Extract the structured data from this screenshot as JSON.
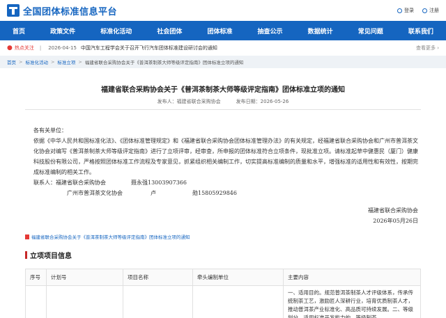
{
  "header": {
    "site_title": "全国团体标准信息平台",
    "login_label": "登录",
    "register_label": "注册"
  },
  "nav": {
    "items": [
      "首页",
      "政策文件",
      "标准化活动",
      "社会团体",
      "团体标准",
      "抽查公示",
      "数据统计",
      "常见问题",
      "联系我们"
    ]
  },
  "hot": {
    "label": "热点关注",
    "date": "2026-04-15",
    "text": "中国汽车工程学会关于召开飞行汽车团体标准建设研讨会的通知",
    "more": "查看更多"
  },
  "breadcrumb": [
    "首页",
    "标准化活动",
    "标准立项",
    "福建省联合采购协会关于《普洱茶制茶大师等级评定指南》团体标准立项的通知"
  ],
  "article": {
    "title": "福建省联合采购协会关于《普洱茶制茶大师等级评定指南》团体标准立项的通知",
    "publisher": "发布人：福建省联合采购协会",
    "publish_time": "发布日期：2026-05-26",
    "salutation": "各有关单位：",
    "paragraph": "依据《中华人民共和国标准化法》、《团体标准管理规定》和《福建省联合采购协会团体标准管理办法》的有关规定，经福建省联合采购协会和广州市普洱茶文化协会对编写《普洱茶制茶大师等级评定指南》进行了立项评审，经审查，所申报的团体标准符合立项条件，现批准立项。请标准起草中健惠民（厦门）健康科技股份有限公司，严格按照团体标准工作流程及专家意见，抓紧组织相关编制工作，切实提高标准编制的质量和水平，增强标准的适用性和有效性，按期完成标准编制的相关工作。",
    "contact_label": "联系人：福建省联合采购协会",
    "contact_1_person": "聂永强13003907366",
    "contact_2_org": "广州市普洱茶文化协会",
    "contact_2_name": "卢",
    "contact_2_phone": "勋15805929846",
    "sign_org": "福建省联合采购协会",
    "sign_date": "2026年05月26日",
    "attachment": "福建省联合采购协会关于《普洱茶制茶大师等级评定指南》团体标准立项的通知"
  },
  "project": {
    "section_title": "立项项目信息",
    "columns": [
      "序号",
      "计划号",
      "项目名称",
      "牵头编制单位",
      "主要内容"
    ],
    "row_content": "一、适用目的。规范普洱茶制茶人才评级体系，传承传统制茶工艺，激励匠人深耕行业，培育优质制茶人才，推动普洱茶产业标准化、高品质可持续发展。二、等级划分。适用标准开发能力的，等级制茶"
  }
}
